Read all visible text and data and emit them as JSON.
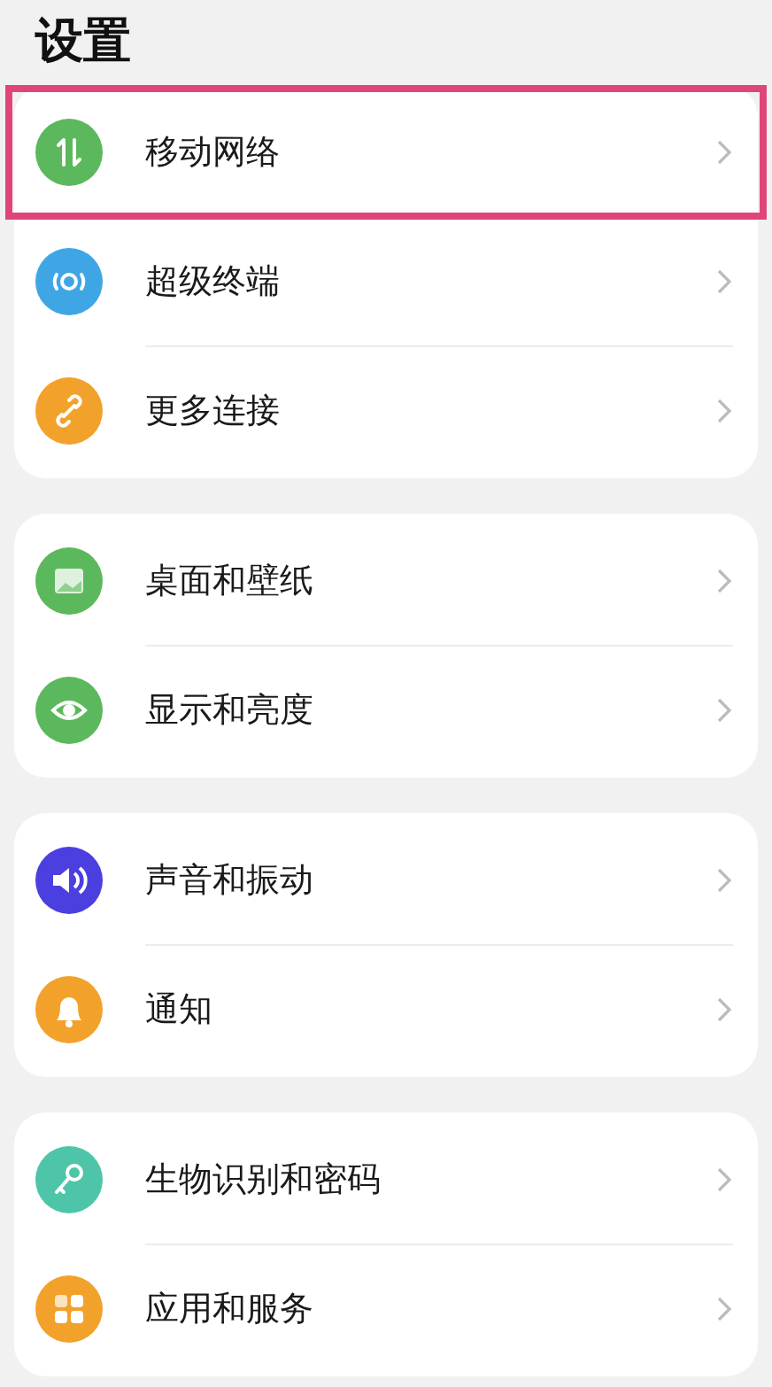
{
  "title": "设置",
  "groups": [
    {
      "items": [
        {
          "label": "移动网络",
          "kind": "updown",
          "color": "#5cb85c",
          "highlighted": true
        },
        {
          "label": "超级终端",
          "kind": "target",
          "color": "#3fa6e6",
          "highlighted": false
        },
        {
          "label": "更多连接",
          "kind": "link",
          "color": "#f2a22b",
          "highlighted": false
        }
      ]
    },
    {
      "items": [
        {
          "label": "桌面和壁纸",
          "kind": "image",
          "color": "#5cb85c",
          "highlighted": false
        },
        {
          "label": "显示和亮度",
          "kind": "eye",
          "color": "#5cb85c",
          "highlighted": false
        }
      ]
    },
    {
      "items": [
        {
          "label": "声音和振动",
          "kind": "speaker",
          "color": "#4b3fe0",
          "highlighted": false
        },
        {
          "label": "通知",
          "kind": "bell",
          "color": "#f2a22b",
          "highlighted": false
        }
      ]
    },
    {
      "items": [
        {
          "label": "生物识别和密码",
          "kind": "key",
          "color": "#4ec5a8",
          "highlighted": false
        },
        {
          "label": "应用和服务",
          "kind": "grid",
          "color": "#f2a22b",
          "highlighted": false
        }
      ]
    }
  ]
}
